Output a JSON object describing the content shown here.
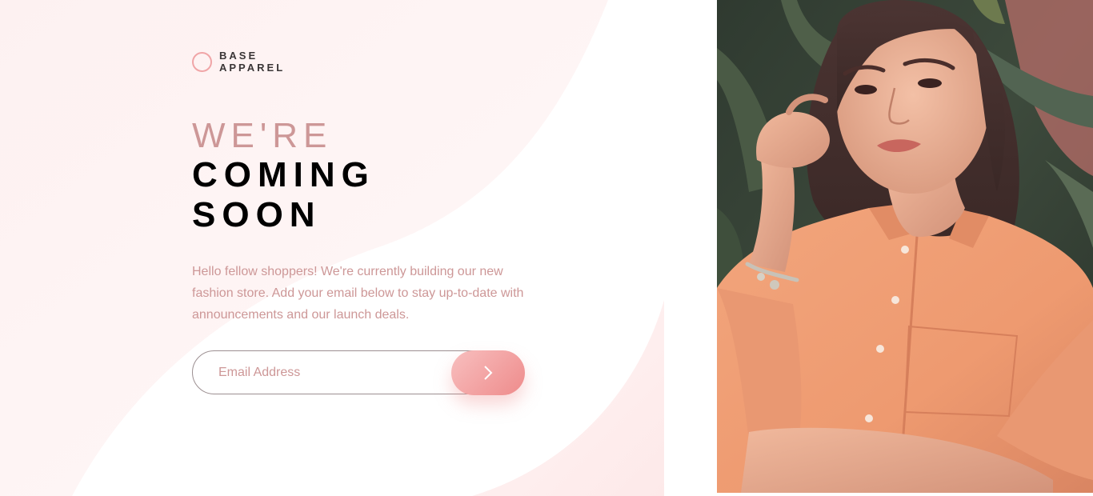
{
  "brand": {
    "line1": "BASE",
    "line2": "APPAREL",
    "accent_color": "#f0a5a7"
  },
  "heading": {
    "light": "WE'RE",
    "bold_line1": "COMING",
    "bold_line2": "SOON"
  },
  "intro_text": "Hello fellow shoppers! We're currently building our new fashion store. Add your email below to stay up-to-date with announcements and our launch deals.",
  "form": {
    "email_placeholder": "Email Address",
    "submit_icon": "chevron-right-icon"
  },
  "hero_image": {
    "description_icon": "hero-photo"
  },
  "colors": {
    "desaturated_red": "#cd9797",
    "dark_text": "#3a3536",
    "button_gradient_start": "#f8bfbf",
    "button_gradient_end": "#ee8b8b"
  }
}
